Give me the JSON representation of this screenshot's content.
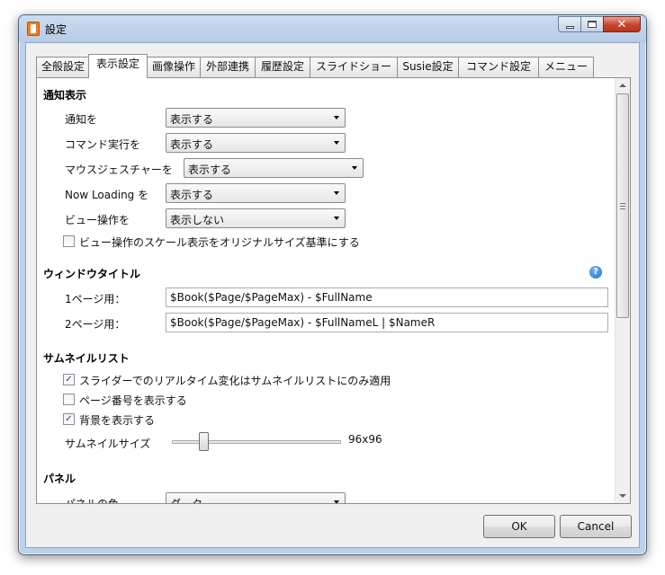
{
  "window": {
    "title": "設定"
  },
  "tabs": [
    "全般設定",
    "表示設定",
    "画像操作",
    "外部連携",
    "履歴設定",
    "スライドショー",
    "Susie設定",
    "コマンド設定",
    "メニュー"
  ],
  "notification": {
    "title": "通知表示",
    "rows": [
      {
        "label": "通知を",
        "value": "表示する"
      },
      {
        "label": "コマンド実行を",
        "value": "表示する"
      },
      {
        "label": "マウスジェスチャーを",
        "value": "表示する"
      },
      {
        "label": "Now Loading を",
        "value": "表示する"
      },
      {
        "label": "ビュー操作を",
        "value": "表示しない"
      }
    ],
    "scale_checkbox": {
      "label": "ビュー操作のスケール表示をオリジナルサイズ基準にする",
      "checked": false
    }
  },
  "window_title": {
    "title": "ウィンドウタイトル",
    "help_icon": "question-mark",
    "page1_label": "1ページ用：",
    "page1_value": "$Book($Page/$PageMax) - $FullName",
    "page2_label": "2ページ用：",
    "page2_value": "$Book($Page/$PageMax) - $FullNameL | $NameR"
  },
  "thumbnail": {
    "title": "サムネイルリスト",
    "checkboxes": [
      {
        "label": "スライダーでのリアルタイム変化はサムネイルリストにのみ適用",
        "checked": true
      },
      {
        "label": "ページ番号を表示する",
        "checked": false
      },
      {
        "label": "背景を表示する",
        "checked": true
      }
    ],
    "size_label": "サムネイルサイズ",
    "size_value": "96x96",
    "size_level": 0.17
  },
  "panel": {
    "title": "パネル",
    "color_label": "パネルの色",
    "color_value": "ダーク"
  },
  "buttons": {
    "ok": "OK",
    "cancel": "Cancel"
  },
  "colors": {
    "frame": "#bcd1ea",
    "help": "#1f6fd2",
    "close_button": "#c8442c"
  }
}
